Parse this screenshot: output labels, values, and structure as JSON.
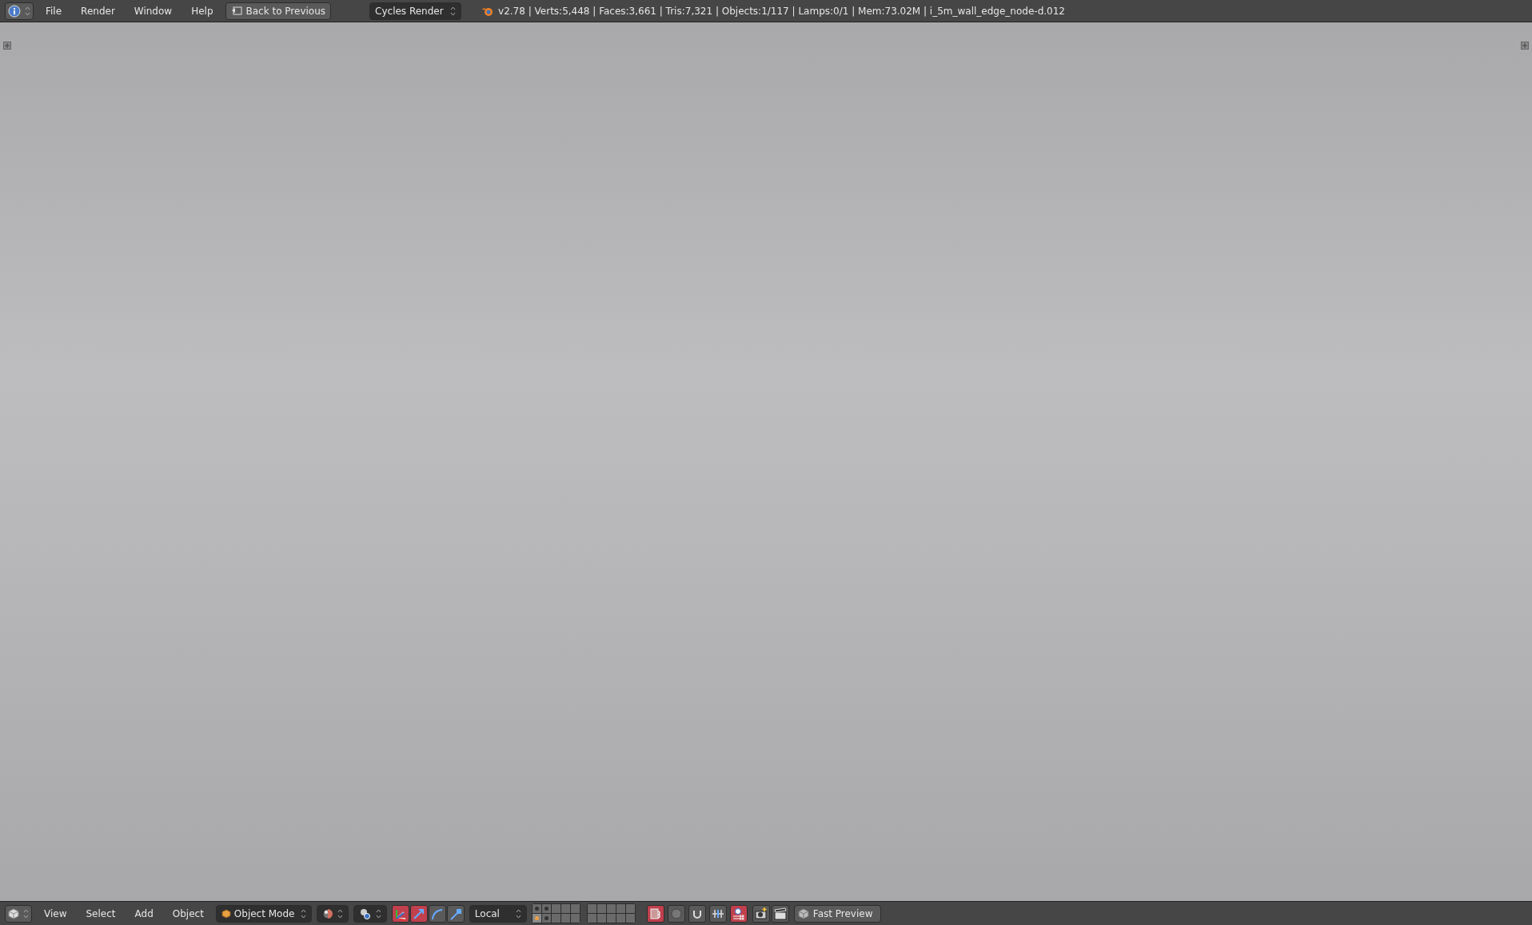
{
  "top_bar": {
    "menus": [
      "File",
      "Render",
      "Window",
      "Help"
    ],
    "back_button": "Back to Previous",
    "render_engine": "Cycles Render",
    "stats": "v2.78 | Verts:5,448 | Faces:3,661 | Tris:7,321 | Objects:1/117 | Lamps:0/1 | Mem:73.02M | i_5m_wall_edge_node-d.012"
  },
  "bottom_bar": {
    "menus": [
      "View",
      "Select",
      "Add",
      "Object"
    ],
    "mode": "Object Mode",
    "manipulators": [
      {
        "kind": "enable",
        "on": true
      },
      {
        "kind": "translate",
        "on": true
      },
      {
        "kind": "rotate",
        "on": false
      },
      {
        "kind": "scale",
        "on": false
      }
    ],
    "orientation": "Local",
    "layers": [
      {
        "used": true,
        "selected": false
      },
      {
        "used": true,
        "selected": false
      },
      {
        "used": false,
        "selected": false
      },
      {
        "used": false,
        "selected": false
      },
      {
        "used": false,
        "selected": false
      },
      {
        "used": true,
        "selected": true
      },
      {
        "used": true,
        "selected": false
      },
      {
        "used": false,
        "selected": false
      },
      {
        "used": false,
        "selected": false
      },
      {
        "used": false,
        "selected": false
      },
      {
        "used": false,
        "selected": false
      },
      {
        "used": false,
        "selected": false
      },
      {
        "used": false,
        "selected": false
      },
      {
        "used": false,
        "selected": false
      },
      {
        "used": false,
        "selected": false
      },
      {
        "used": false,
        "selected": false
      },
      {
        "used": false,
        "selected": false
      },
      {
        "used": false,
        "selected": false
      },
      {
        "used": false,
        "selected": false
      },
      {
        "used": false,
        "selected": false
      }
    ],
    "toggles": [
      {
        "kind": "lock",
        "on": true
      },
      {
        "kind": "proportional",
        "on": false
      },
      {
        "kind": "snap",
        "on": false
      },
      {
        "kind": "snap_element",
        "on": false
      },
      {
        "kind": "snap_target",
        "on": true
      }
    ],
    "preview_button": "Fast Preview"
  }
}
